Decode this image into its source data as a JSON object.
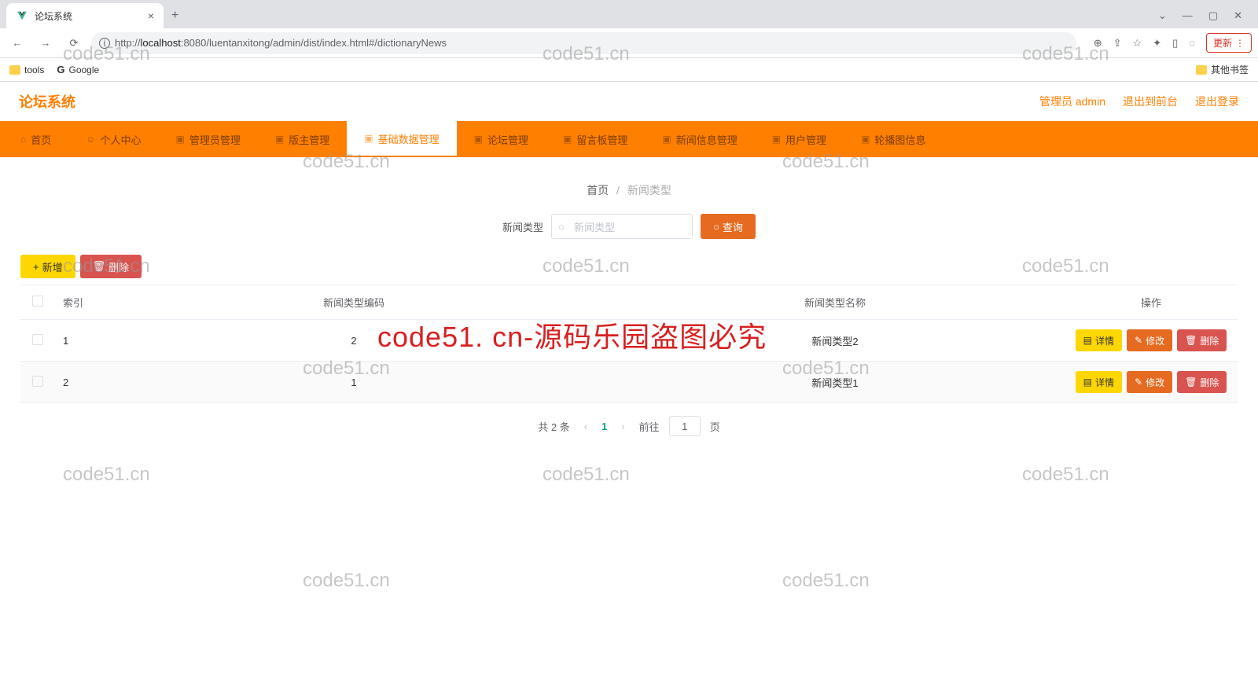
{
  "browser": {
    "tab_title": "论坛系统",
    "url_prefix": "http://",
    "url_host": "localhost",
    "url_path": ":8080/luentanxitong/admin/dist/index.html#/dictionaryNews",
    "update_label": "更新",
    "bookmarks": {
      "tools": "tools",
      "google": "Google",
      "other": "其他书签"
    }
  },
  "header": {
    "brand": "论坛系统",
    "admin": "管理员 admin",
    "to_front": "退出到前台",
    "logout": "退出登录"
  },
  "nav": {
    "items": [
      {
        "label": "首页"
      },
      {
        "label": "个人中心"
      },
      {
        "label": "管理员管理"
      },
      {
        "label": "版主管理"
      },
      {
        "label": "基础数据管理"
      },
      {
        "label": "论坛管理"
      },
      {
        "label": "留言板管理"
      },
      {
        "label": "新闻信息管理"
      },
      {
        "label": "用户管理"
      },
      {
        "label": "轮播图信息"
      }
    ],
    "active_index": 4
  },
  "breadcrumb": {
    "root": "首页",
    "current": "新闻类型"
  },
  "search": {
    "label": "新闻类型",
    "placeholder": "新闻类型",
    "button": "查询"
  },
  "toolbar": {
    "add": "新增",
    "delete": "删除"
  },
  "table": {
    "headers": {
      "index": "索引",
      "code": "新闻类型编码",
      "name": "新闻类型名称",
      "op": "操作"
    },
    "rows": [
      {
        "index": "1",
        "code": "2",
        "name": "新闻类型2"
      },
      {
        "index": "2",
        "code": "1",
        "name": "新闻类型1"
      }
    ],
    "op_labels": {
      "detail": "详情",
      "edit": "修改",
      "delete": "删除"
    }
  },
  "pager": {
    "total": "共 2 条",
    "page": "1",
    "goto": "前往",
    "goto_value": "1",
    "page_suffix": "页"
  },
  "watermark": {
    "small": "code51.cn",
    "big": "code51. cn-源码乐园盗图必究"
  }
}
